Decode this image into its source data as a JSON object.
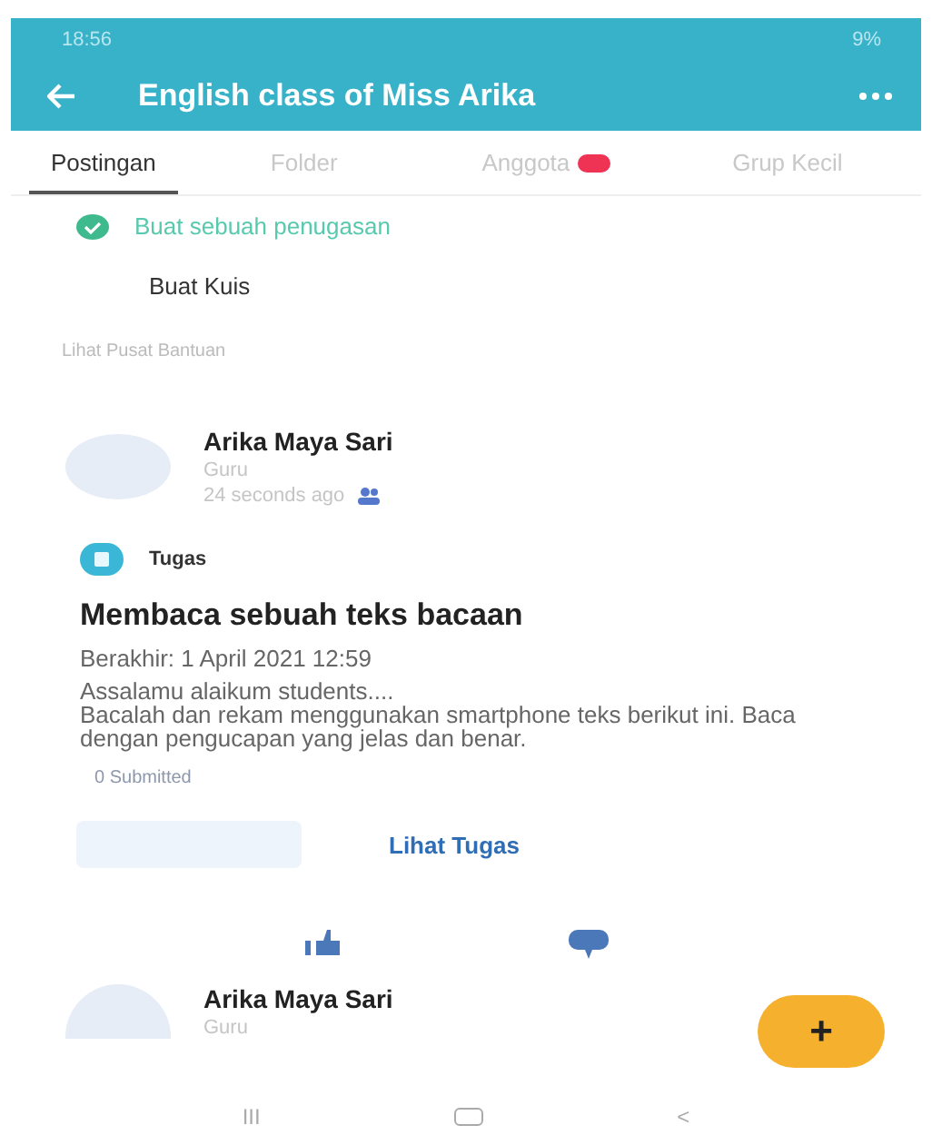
{
  "status_bar": {
    "time": "18:56",
    "battery": "9%"
  },
  "app_bar": {
    "title": "English class of Miss Arika"
  },
  "tabs": [
    {
      "label": "Postingan",
      "selected": true,
      "badge": false
    },
    {
      "label": "Folder",
      "selected": false,
      "badge": false
    },
    {
      "label": "Anggota",
      "selected": false,
      "badge": true
    },
    {
      "label": "Grup Kecil",
      "selected": false,
      "badge": false
    }
  ],
  "actions": [
    {
      "kind": "check",
      "label": "Buat sebuah penugasan"
    },
    {
      "kind": "plain",
      "label": "Buat Kuis"
    },
    {
      "kind": "hint",
      "label": "Lihat Pusat Bantuan"
    }
  ],
  "post": {
    "author": "Arika Maya Sari",
    "role": "Guru",
    "time": "24 seconds ago",
    "type": "Tugas",
    "title": "Membaca sebuah teks bacaan",
    "due": "Berakhir: 1 April 2021 12:59",
    "body": [
      "Assalamu alaikum students....",
      "Bacalah dan rekam menggunakan smartphone teks berikut ini. Baca dengan pengucapan yang jelas dan benar."
    ],
    "submitted": "0 Submitted",
    "button": "Lihat Tugas"
  },
  "next_post": {
    "author": "Arika Maya Sari",
    "role": "Guru"
  },
  "fab": "+",
  "nav": {
    "recents": "III",
    "back": "<"
  }
}
